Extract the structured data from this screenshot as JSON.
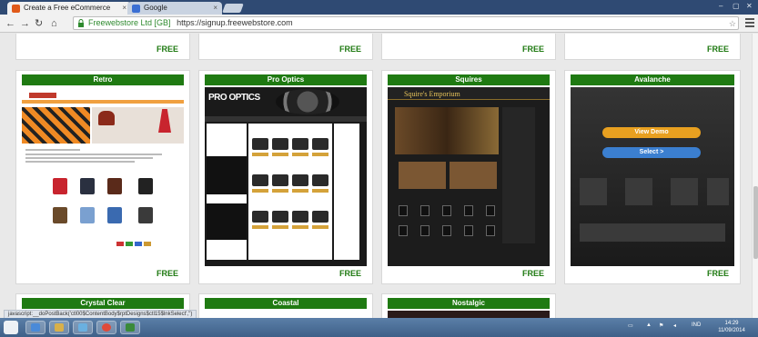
{
  "browser": {
    "tabs": [
      {
        "label": "Create a Free eCommerce",
        "favicon_color": "#e05a1a"
      },
      {
        "label": "Google",
        "favicon_color": "#3b6fd3"
      }
    ],
    "address_ev": "Freewebstore Ltd [GB]",
    "address_url": "https://signup.freewebstore.com",
    "window_controls": [
      "–",
      "▢",
      "✕"
    ]
  },
  "row_top_free": [
    "FREE",
    "FREE",
    "FREE",
    "FREE"
  ],
  "templates": [
    {
      "name": "Retro",
      "free": "FREE"
    },
    {
      "name": "Pro Optics",
      "free": "FREE",
      "logo": "PRO OPTICS"
    },
    {
      "name": "Squires",
      "free": "FREE",
      "store_name": "Squire's Emporium"
    },
    {
      "name": "Avalanche",
      "free": "FREE",
      "view_demo": "View Demo",
      "select": "Select >"
    }
  ],
  "bottom_templates": [
    {
      "name": "Crystal Clear"
    },
    {
      "name": "Coastal"
    },
    {
      "name": "Nostalgic"
    }
  ],
  "status_text": "javascript:__doPostBack('ctl00$ContentBody$rptDesigns$ctl15$lnkSelect','')",
  "taskbar": {
    "lang": "IND",
    "time": "14:29",
    "date": "11/09/2014"
  },
  "colors": {
    "accent_green": "#1f7a12",
    "view_demo": "#e8a020",
    "select": "#3b7fd0"
  }
}
